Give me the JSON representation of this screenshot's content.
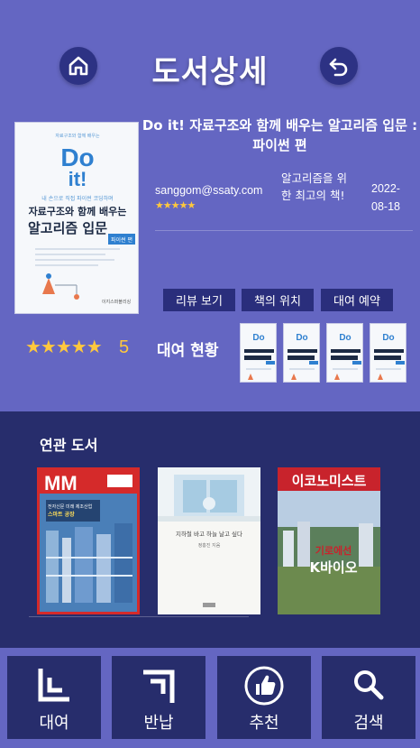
{
  "header": {
    "title": "도서상세"
  },
  "book": {
    "title": "Do it! 자료구조와 함께 배우는 알고리즘 입문 : 파이썬 편",
    "email": "sanggom@ssaty.com",
    "mini_stars": "★★★★★",
    "category": "알고리즘을 위한 최고의 책!",
    "date": "2022-08-18",
    "cover": {
      "top_small": "자료구조와 함께 배우는",
      "logo_line1": "Do",
      "logo_line2": "it!",
      "subtitle": "내 손으로 직접 파이썬 코딩하며",
      "title_line1": "자료구조와 함께 배우는",
      "title_line2": "알고리즘 입문",
      "badge": "파이썬 편",
      "publisher": "이지스퍼블리싱"
    }
  },
  "actions": {
    "review": "리뷰 보기",
    "location": "책의 위치",
    "reserve": "대여 예약"
  },
  "rating": {
    "stars": "★★★★★",
    "value": "5"
  },
  "rental_status": {
    "label": "대여 현황",
    "count": 4
  },
  "related": {
    "title": "연관 도서",
    "books": [
      {
        "masthead": "MM",
        "line1": "전자신문 미래 제조산업",
        "line2": "스마트 공장"
      },
      {
        "text": "지하철 바고 하늘 날고 싶다",
        "author": "정홍진 지음"
      },
      {
        "masthead": "이코노미스트",
        "headline1": "기로에선",
        "headline2": "K바이오"
      }
    ]
  },
  "nav": {
    "rent": "대여",
    "return": "반납",
    "recommend": "추천",
    "search": "검색"
  },
  "colors": {
    "primary": "#6466c2",
    "dark": "#272d6c",
    "button": "#2a2e7c",
    "star": "#ffc83d"
  }
}
